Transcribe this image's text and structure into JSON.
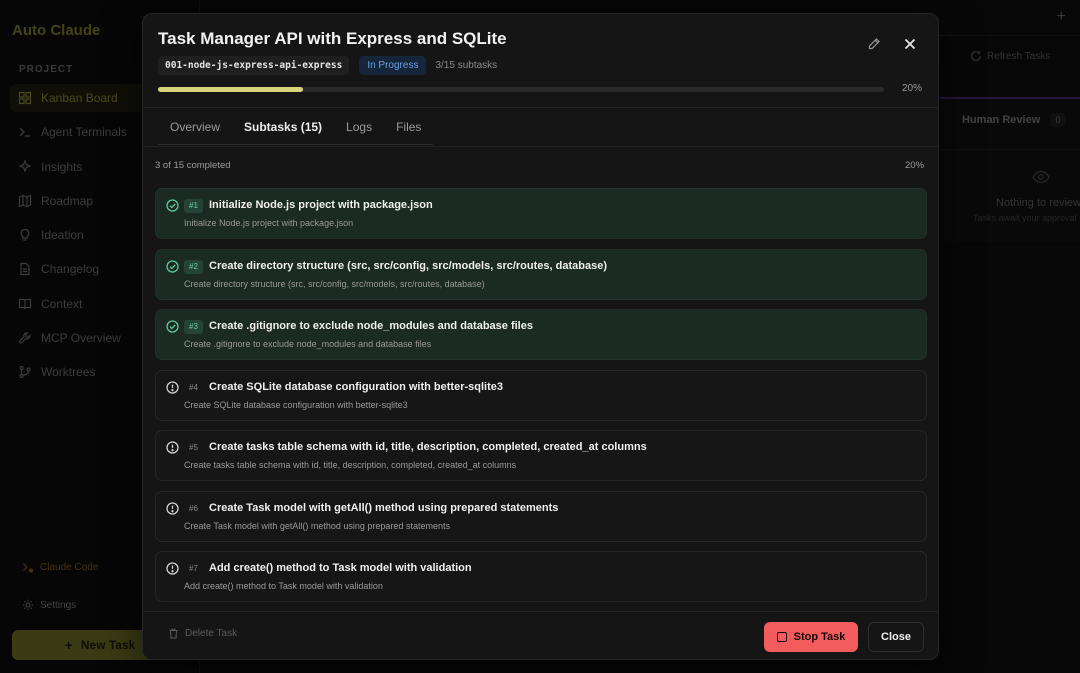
{
  "app": {
    "title": "Auto Claude"
  },
  "sidebar": {
    "section": "PROJECT",
    "items": [
      {
        "label": "Kanban Board",
        "icon": "kanban-icon"
      },
      {
        "label": "Agent Terminals",
        "icon": "terminal-icon"
      },
      {
        "label": "Insights",
        "icon": "sparkles-icon"
      },
      {
        "label": "Roadmap",
        "icon": "map-icon"
      },
      {
        "label": "Ideation",
        "icon": "lightbulb-icon"
      },
      {
        "label": "Changelog",
        "icon": "document-icon"
      },
      {
        "label": "Context",
        "icon": "book-icon"
      },
      {
        "label": "MCP Overview",
        "icon": "wrench-icon"
      },
      {
        "label": "Worktrees",
        "icon": "git-branch-icon"
      }
    ],
    "claude_code": "Claude Code",
    "settings": "Settings",
    "new_task": "New Task"
  },
  "background": {
    "refresh": "Refresh Tasks",
    "column_title": "Human Review",
    "column_count": "0",
    "empty_title": "Nothing to review",
    "empty_sub": "Tasks await your approval"
  },
  "modal": {
    "title": "Task Manager API with Express and SQLite",
    "spec": "001-node-js-express-api-express",
    "status": "In Progress",
    "subtask_count": "3/15 subtasks",
    "progress": 0.2,
    "progress_label": "20%",
    "tabs": [
      "Overview",
      "Subtasks (15)",
      "Logs",
      "Files"
    ],
    "completed_text": "3 of 15 completed",
    "completed_pct": "20%",
    "subtasks": [
      {
        "num": "#1",
        "title": "Initialize Node.js project with package.json",
        "desc": "Initialize Node.js project with package.json",
        "done": true
      },
      {
        "num": "#2",
        "title": "Create directory structure (src, src/config, src/models, src/routes, database)",
        "desc": "Create directory structure (src, src/config, src/models, src/routes, database)",
        "done": true
      },
      {
        "num": "#3",
        "title": "Create .gitignore to exclude node_modules and database files",
        "desc": "Create .gitignore to exclude node_modules and database files",
        "done": true
      },
      {
        "num": "#4",
        "title": "Create SQLite database configuration with better-sqlite3",
        "desc": "Create SQLite database configuration with better-sqlite3",
        "done": false
      },
      {
        "num": "#5",
        "title": "Create tasks table schema with id, title, description, completed, created_at columns",
        "desc": "Create tasks table schema with id, title, description, completed, created_at columns",
        "done": false
      },
      {
        "num": "#6",
        "title": "Create Task model with getAll() method using prepared statements",
        "desc": "Create Task model with getAll() method using prepared statements",
        "done": false
      },
      {
        "num": "#7",
        "title": "Add create() method to Task model with validation",
        "desc": "Add create() method to Task model with validation",
        "done": false
      }
    ],
    "delete_label": "Delete Task",
    "stop_label": "Stop Task",
    "close_label": "Close"
  },
  "colors": {
    "accent": "#d8d37a",
    "done_bg": "#1b2a22",
    "done_icon": "#5fc79a",
    "stop": "#f25c5c",
    "status_text": "#6aa0e6"
  }
}
